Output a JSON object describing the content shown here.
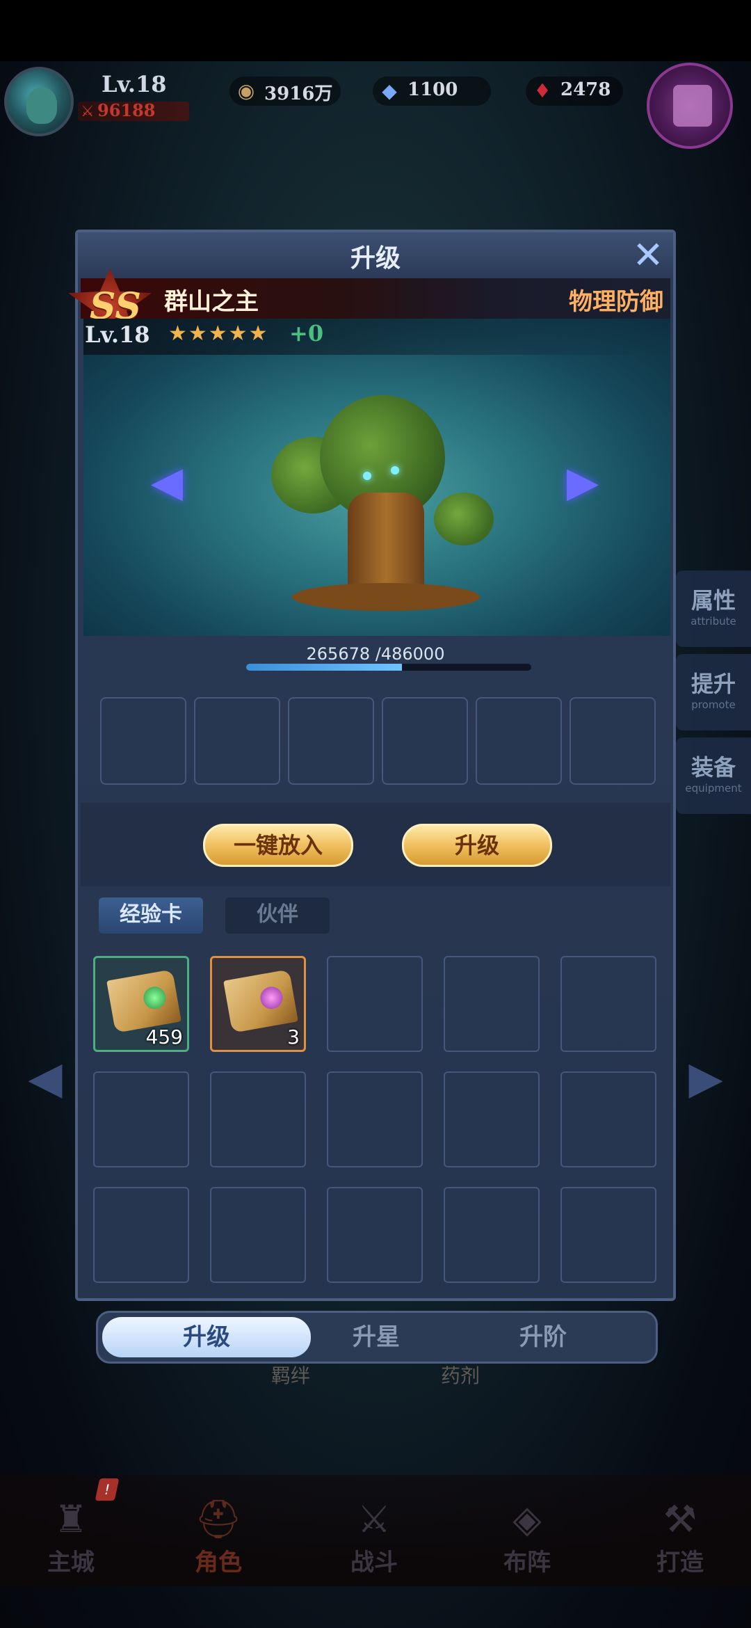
{
  "hud": {
    "level": "Lv.18",
    "power": "96188",
    "gold": "3916万",
    "diamonds": "1100",
    "rubies": "2478"
  },
  "side_tabs": [
    {
      "cn": "属性",
      "en": "attribute"
    },
    {
      "cn": "提升",
      "en": "promote"
    },
    {
      "cn": "装备",
      "en": "equipment"
    }
  ],
  "modal": {
    "title": "升级",
    "close_icon": "close-icon",
    "hero": {
      "rank": "SS",
      "name": "群山之主",
      "class": "物理防御",
      "level": "Lv.18",
      "stars": "★★★★★",
      "plus": "+0"
    },
    "exp": {
      "text": "265678 /486000",
      "current": 265678,
      "max": 486000
    },
    "buttons": {
      "auto_fill": "一键放入",
      "upgrade": "升级"
    },
    "subtabs": {
      "exp_card": "经验卡",
      "partner": "伙伴"
    },
    "items": [
      {
        "count": "459",
        "rarity": "green",
        "gem_color": "#4ac060"
      },
      {
        "count": "3",
        "rarity": "orange",
        "gem_color": "#c050d0"
      }
    ],
    "mode_tabs": {
      "level_up": "升级",
      "star_up": "升星",
      "rank_up": "升阶"
    }
  },
  "bottom_labels": {
    "bond": "羁绊",
    "potion": "药剂"
  },
  "bottom_nav": [
    {
      "label": "主城",
      "icon": "castle-icon"
    },
    {
      "label": "角色",
      "icon": "helmet-icon"
    },
    {
      "label": "战斗",
      "icon": "swords-icon"
    },
    {
      "label": "布阵",
      "icon": "formation-icon"
    },
    {
      "label": "打造",
      "icon": "anvil-icon"
    }
  ],
  "nav_badge": "!"
}
